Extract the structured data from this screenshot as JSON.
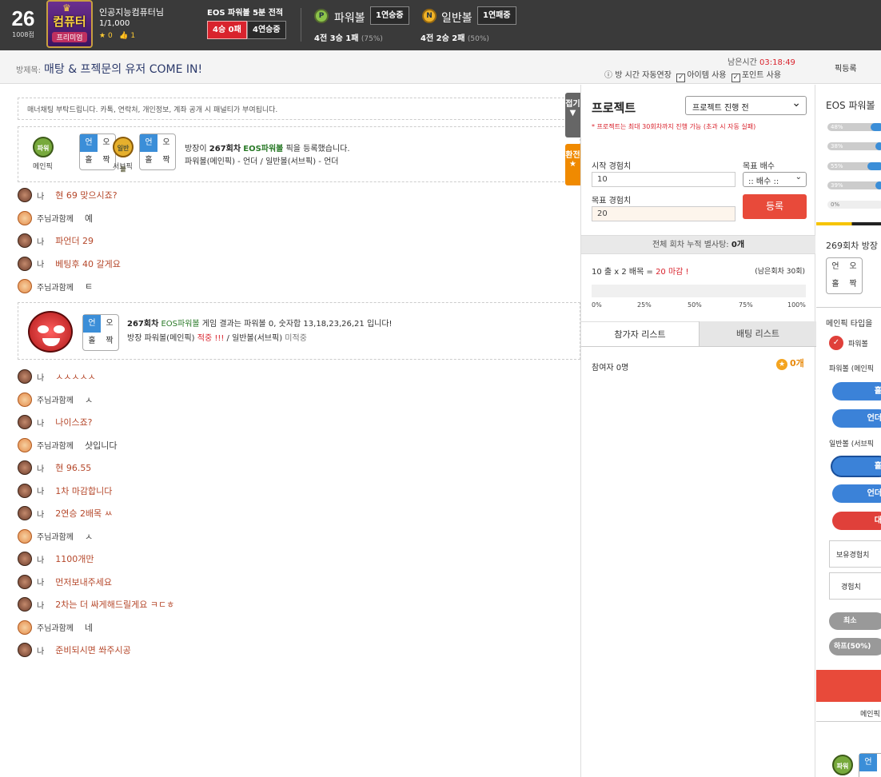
{
  "header": {
    "level": "26",
    "points": "1008점",
    "avatar_title": "컴퓨터",
    "avatar_sub": "프리미엄",
    "user_name": "인공지능컴퓨터님",
    "user_rank": "1/1,000",
    "star_count": "0",
    "like_count": "1",
    "eos_title": "EOS 파워볼 5분 전적",
    "record_win": "4승 0패",
    "record_streak": "4연승중",
    "powerball_label": "파워볼",
    "powerball_badge": "1연승중",
    "powerball_record": "4전 3승 1패",
    "powerball_rate": "(75%)",
    "normalball_label": "일반볼",
    "normalball_badge": "1연패중",
    "normalball_record": "4전 2승 2패",
    "normalball_rate": "(50%)"
  },
  "room": {
    "title_label": "방제목:",
    "title": "매탕 & 프젝문의 유저 COME IN!",
    "remaining_label": "남은시간",
    "remaining_time": "03:18:49",
    "opt_extend": "방 시간 자동연장",
    "opt_item": "아이템 사용",
    "opt_point": "포인트 사용",
    "register": "픽등록"
  },
  "chat": {
    "notice": "매너채팅 부탁드립니다. 카톡, 연락처, 개인정보, 계좌 공개 시 패널티가 부여됩니다.",
    "pick_main_ball": "파워볼",
    "pick_main_label": "메인픽",
    "pick_sub_ball": "일반볼",
    "pick_sub_label": "서브픽",
    "grid_labels": [
      "언",
      "오",
      "홀",
      "짝"
    ],
    "pick_line1_pre": "방장이 ",
    "pick_line1_round": "267회차",
    "pick_line1_game": "EOS파워볼",
    "pick_line1_post": " 픽을 등록했습니다.",
    "pick_line2": "파워볼(메인픽) - 언더 / 일반볼(서브픽) - 언더",
    "tab_fold": "접기",
    "tab_convert": "환전",
    "messages_top": [
      {
        "who": "나",
        "text": "현 69 맞으시죠?"
      },
      {
        "who": "주님과함께",
        "text": "예"
      },
      {
        "who": "나",
        "text": "파언더 29"
      },
      {
        "who": "나",
        "text": "베팅후 40 갈게요"
      },
      {
        "who": "주님과함께",
        "text": "ㅌ"
      }
    ],
    "result_round": "267회차",
    "result_game": "EOS파워볼",
    "result_line1_post": " 게임 결과는 파워볼 0, 숫자합 13,18,23,26,21 입니다!",
    "result_line2_pre": "방장 파워볼(메인픽) ",
    "result_hit": "적중 !!!",
    "result_line2_mid": " / 일반볼(서브픽) ",
    "result_miss": "미적중",
    "messages_bottom": [
      {
        "who": "나",
        "text": "ㅅㅅㅅㅅㅅ"
      },
      {
        "who": "주님과함께",
        "text": "ㅅ"
      },
      {
        "who": "나",
        "text": "나이스죠?"
      },
      {
        "who": "주님과함께",
        "text": "샷입니다"
      },
      {
        "who": "나",
        "text": "현 96.55"
      },
      {
        "who": "나",
        "text": "1차 마감합니다"
      },
      {
        "who": "나",
        "text": "2연승 2배목 ㅆ"
      },
      {
        "who": "주님과함께",
        "text": "ㅅ"
      },
      {
        "who": "나",
        "text": "1100개만"
      },
      {
        "who": "나",
        "text": "먼저보내주세요"
      },
      {
        "who": "나",
        "text": "2차는 더 싸게해드릴게요 ㅋㄷㅎ"
      },
      {
        "who": "주님과함께",
        "text": "네"
      },
      {
        "who": "나",
        "text": "준비되시면 쏴주시공"
      }
    ]
  },
  "project": {
    "title": "프로젝트",
    "status_select": "프로젝트 진행 전",
    "warning": "* 프로젝트는 최대 30회차까지 진행 가능 (초과 시 자동 실패)",
    "start_label": "시작 경험치",
    "start_value": "10",
    "target_label": "목표 경험치",
    "target_value": "20",
    "mult_label": "목표 배수",
    "mult_select": ":: 배수 ::",
    "register_btn": "등록",
    "cum_pre": "전체 회차 누적 별사탕: ",
    "cum_value": "0개",
    "row_text": "10 출 x 2 배목 = ",
    "row_red": "20 마감 !",
    "remaining_rounds": "(남은회차 30회)",
    "progress": 0,
    "ticks": [
      "0%",
      "25%",
      "50%",
      "75%",
      "100%"
    ],
    "tab_participants": "참가자 리스트",
    "tab_betting": "배팅 리스트",
    "participants": "참여자 0명",
    "stars": "0개"
  },
  "right": {
    "title": "EOS 파워볼",
    "bars": [
      {
        "label": "48%"
      },
      {
        "label": "38%"
      },
      {
        "label": "55%"
      },
      {
        "label": "39%"
      },
      {
        "label": "0%"
      }
    ],
    "round_title": "269회차 방장",
    "main_type": "메인픽 타입을",
    "main_opt": "파워볼",
    "pb_label": "파워볼 (메인픽",
    "nb_label": "일반볼 (서브픽",
    "btn_odd": "홀",
    "btn_under": "언더",
    "btn_big": "대",
    "exp_own": "보유경험치",
    "exp": "경험치",
    "min_btn": "최소",
    "half_btn": "하프(50%)",
    "main_footer": "메인픽"
  }
}
